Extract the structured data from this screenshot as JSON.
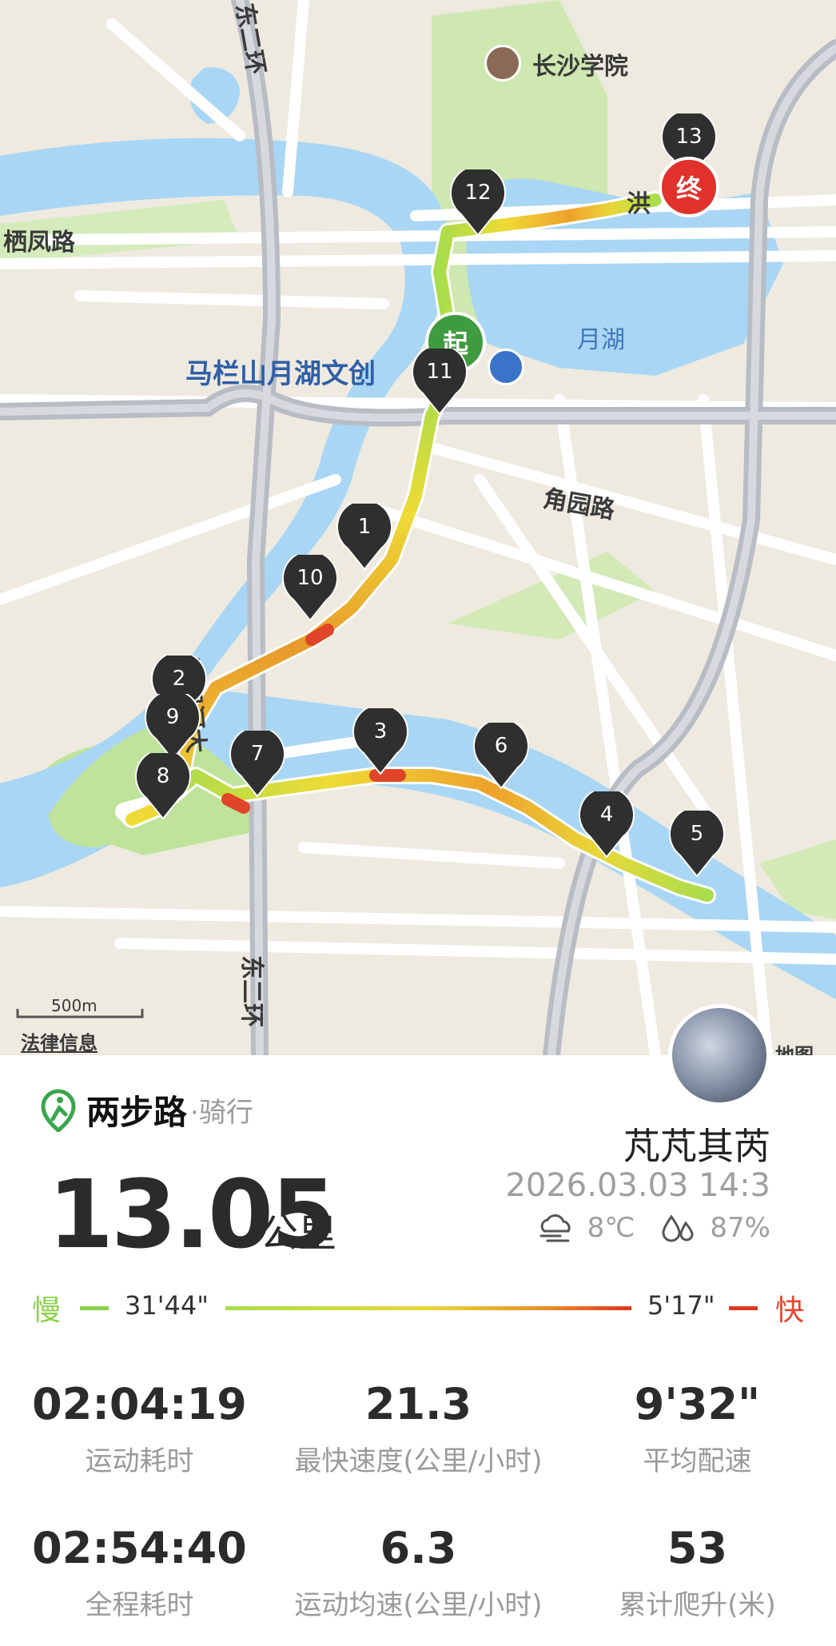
{
  "map": {
    "labels": {
      "changsha_college": "长沙学院",
      "qifeng_road": "栖凤路",
      "malanshan": "马栏山月湖文创",
      "yuehu": "月湖",
      "puyuan_road": "角园路",
      "liuyanghe_bridge": "浏阳河大",
      "dong_erhuan_top": "东二环",
      "dong_erhuan_bottom": "东二环",
      "hong": "洪",
      "metro": "地图",
      "scale": "500m",
      "legal": "法律信息"
    },
    "start_label": "起",
    "end_label": "终",
    "markers": [
      "1",
      "2",
      "3",
      "4",
      "5",
      "6",
      "7",
      "8",
      "9",
      "10",
      "11",
      "12",
      "13"
    ]
  },
  "brand": {
    "name": "两步路",
    "type": "·骑行",
    "color": "#3aa64c"
  },
  "activity": {
    "distance": "13.05",
    "distance_unit": "公里",
    "username": "芃芃其芮",
    "datetime": "2026.03.03 14:3",
    "temperature": "8℃",
    "humidity": "87%"
  },
  "pace": {
    "slow_label": "慢",
    "slow_value": "31'44\"",
    "fast_value": "5'17\"",
    "fast_label": "快"
  },
  "stats": [
    {
      "value": "02:04:19",
      "label": "运动耗时"
    },
    {
      "value": "21.3",
      "label": "最快速度(公里/小时)"
    },
    {
      "value": "9'32\"",
      "label": "平均配速"
    },
    {
      "value": "02:54:40",
      "label": "全程耗时"
    },
    {
      "value": "6.3",
      "label": "运动均速(公里/小时)"
    },
    {
      "value": "53",
      "label": "累计爬升(米)"
    }
  ],
  "colors": {
    "river": "#a9d6f5",
    "park": "#c9e7a4",
    "road": "#ffffff",
    "route_slow": "#a8dd4b",
    "route_fast": "#e0452a",
    "start": "#3f9b3f",
    "end": "#e0312a",
    "pin": "#2f2f2f"
  }
}
